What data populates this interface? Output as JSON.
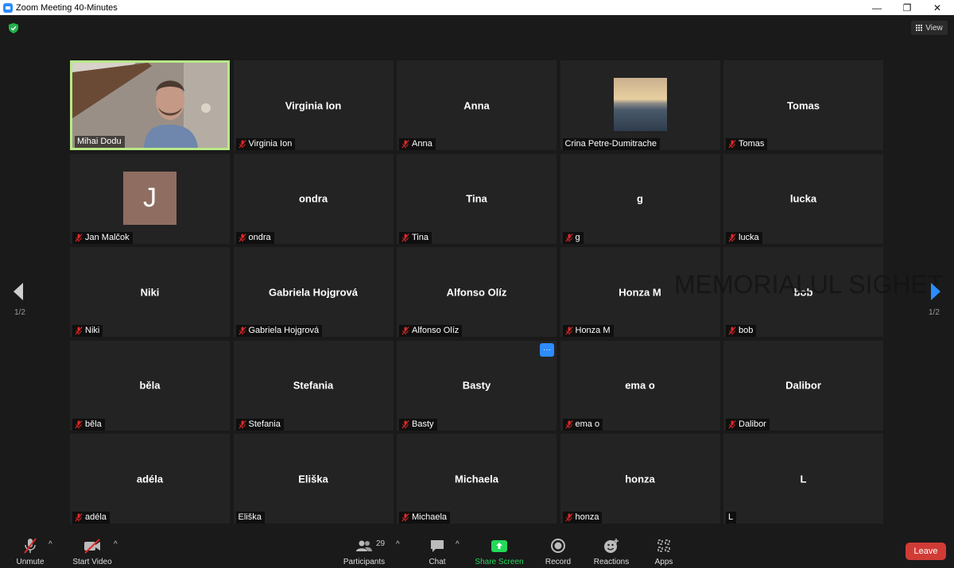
{
  "window": {
    "title": "Zoom Meeting 40-Minutes",
    "minimize": "—",
    "restore": "❐",
    "close": "✕"
  },
  "header": {
    "view_label": "View"
  },
  "pagination": {
    "left": "1/2",
    "right": "1/2"
  },
  "watermark": "MEMORIALUL SIGHET",
  "tiles": [
    {
      "center": "",
      "label": "Mihai Dodu",
      "muted": false,
      "video": true
    },
    {
      "center": "Virginia Ion",
      "label": "Virginia Ion",
      "muted": true
    },
    {
      "center": "Anna",
      "label": "Anna",
      "muted": true
    },
    {
      "center": "",
      "label": "Crina Petre-Dumitrache",
      "muted": false,
      "avatar": "sunset"
    },
    {
      "center": "Tomas",
      "label": "Tomas",
      "muted": true
    },
    {
      "center": "",
      "label": "Jan Malčok",
      "muted": true,
      "avatar": "J"
    },
    {
      "center": "ondra",
      "label": "ondra",
      "muted": true
    },
    {
      "center": "Tina",
      "label": "Tina",
      "muted": true
    },
    {
      "center": "g",
      "label": "g",
      "muted": true
    },
    {
      "center": "lucka",
      "label": "lucka",
      "muted": true
    },
    {
      "center": "Niki",
      "label": "Niki",
      "muted": true
    },
    {
      "center": "Gabriela Hojgrová",
      "label": "Gabriela Hojgrová",
      "muted": true
    },
    {
      "center": "Alfonso Olíz",
      "label": "Alfonso Olíz",
      "muted": true
    },
    {
      "center": "Honza M",
      "label": "Honza M",
      "muted": true
    },
    {
      "center": "bob",
      "label": "bob",
      "muted": true
    },
    {
      "center": "běla",
      "label": "běla",
      "muted": true
    },
    {
      "center": "Stefania",
      "label": "Stefania",
      "muted": true
    },
    {
      "center": "Basty",
      "label": "Basty",
      "muted": true,
      "more": "···"
    },
    {
      "center": "ema o",
      "label": "ema o",
      "muted": true
    },
    {
      "center": "Dalibor",
      "label": "Dalibor",
      "muted": true
    },
    {
      "center": "adéla",
      "label": "adéla",
      "muted": true
    },
    {
      "center": "Eliška",
      "label": "Eliška",
      "muted": false
    },
    {
      "center": "Michaela",
      "label": "Michaela",
      "muted": true
    },
    {
      "center": "honza",
      "label": "honza",
      "muted": true
    },
    {
      "center": "L",
      "label": "L",
      "muted": false
    }
  ],
  "toolbar": {
    "unmute": "Unmute",
    "start_video": "Start Video",
    "participants": "Participants",
    "participants_count": "29",
    "chat": "Chat",
    "share_screen": "Share Screen",
    "record": "Record",
    "reactions": "Reactions",
    "apps": "Apps",
    "leave": "Leave"
  },
  "colors": {
    "accent": "#2d8cff",
    "share": "#23d959",
    "leave": "#d13b36",
    "active_border": "#b8e986",
    "muted": "#e02828"
  }
}
